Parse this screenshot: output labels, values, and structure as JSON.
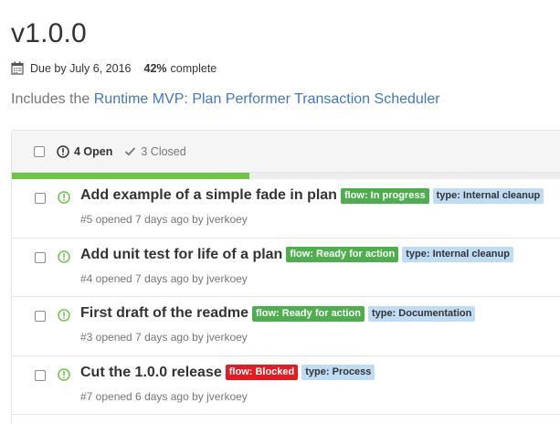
{
  "milestone": {
    "title": "v1.0.0",
    "due": "Due by July 6, 2016",
    "percent": "42%",
    "complete_label": "complete",
    "progress_fraction": 0.42
  },
  "description": {
    "prefix": "Includes the ",
    "link": "Runtime MVP: Plan Performer Transaction Scheduler"
  },
  "tabs": {
    "open": "4 Open",
    "closed": "3 Closed"
  },
  "issues": [
    {
      "title": "Add example of a simple fade in plan",
      "meta": "#5 opened 7 days ago by jverkoey",
      "labels": [
        {
          "text": "flow: In progress",
          "bg": "#4cae4c",
          "fg": "#ffffff"
        },
        {
          "text": "type: Internal cleanup",
          "bg": "#bfdcf5",
          "fg": "#333333"
        }
      ]
    },
    {
      "title": "Add unit test for life of a plan",
      "meta": "#4 opened 7 days ago by jverkoey",
      "labels": [
        {
          "text": "flow: Ready for action",
          "bg": "#4cae4c",
          "fg": "#ffffff"
        },
        {
          "text": "type: Internal cleanup",
          "bg": "#bfdcf5",
          "fg": "#333333"
        }
      ]
    },
    {
      "title": "First draft of the readme",
      "meta": "#3 opened 7 days ago by jverkoey",
      "labels": [
        {
          "text": "flow: Ready for action",
          "bg": "#4cae4c",
          "fg": "#ffffff"
        },
        {
          "text": "type: Documentation",
          "bg": "#bfdcf5",
          "fg": "#333333"
        }
      ]
    },
    {
      "title": "Cut the 1.0.0 release",
      "meta": "#7 opened 6 days ago by jverkoey",
      "labels": [
        {
          "text": "flow: Blocked",
          "bg": "#e11d21",
          "fg": "#ffffff"
        },
        {
          "text": "type: Process",
          "bg": "#bfdcf5",
          "fg": "#333333"
        }
      ]
    }
  ],
  "colors": {
    "open_icon": "#6cc644",
    "link": "#4078c0",
    "progress": "#6cc644"
  },
  "icons": {
    "calendar": "calendar-icon",
    "issue_open": "issue-opened-icon",
    "check": "check-icon"
  }
}
